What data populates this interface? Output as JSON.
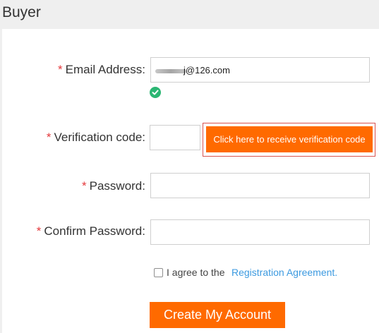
{
  "header": {
    "title": "Buyer"
  },
  "form": {
    "required_mark": "*",
    "email": {
      "label": "Email Address:",
      "value_visible": "j@126.com",
      "status_icon": "check-circle-icon"
    },
    "verification": {
      "label": "Verification code:",
      "value": "",
      "button_label": "Click here to receive verification code"
    },
    "password": {
      "label": "Password:",
      "value": ""
    },
    "confirm_password": {
      "label": "Confirm Password:",
      "value": ""
    },
    "agreement": {
      "checked": false,
      "text": "I agree to the",
      "link_text": "Registration Agreement."
    },
    "submit_label": "Create My Account"
  },
  "colors": {
    "accent": "#ff6a00",
    "required": "#e4393c",
    "link": "#3c9ae0",
    "success": "#2bb673",
    "highlight_border": "#d9534f"
  }
}
